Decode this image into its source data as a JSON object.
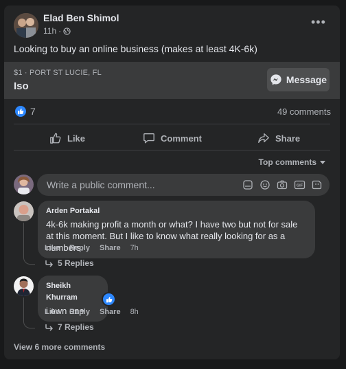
{
  "post": {
    "author": "Elad Ben Shimol",
    "time": "11h",
    "visibility_icon": "globe-icon",
    "more_icon": "more-dots-icon",
    "more_label": "•••",
    "text": "Looking to buy an online business (makes at least 4K-6k)"
  },
  "listing": {
    "location": "$1 · PORT ST LUCIE, FL",
    "title": "Iso",
    "message_label": "Message"
  },
  "reactions": {
    "count": "7",
    "comments": "49 comments"
  },
  "actions": {
    "like": "Like",
    "comment": "Comment",
    "share": "Share"
  },
  "sort": {
    "label": "Top comments"
  },
  "composer": {
    "placeholder": "Write a public comment...",
    "tools": [
      "sticker-icon",
      "emoji-icon",
      "camera-icon",
      "gif-icon",
      "avatar-sticker-icon"
    ]
  },
  "comments": [
    {
      "author": "Arden Portakal",
      "text": "4k-6k making profit a month or what? I have two but not for sale at this moment. But I like to know what really looking for as a numbers.",
      "like": "Like",
      "reply": "Reply",
      "share": "Share",
      "time": "7h",
      "replies": "5 Replies"
    },
    {
      "author": "Sheikh Khurram",
      "text": "i own one",
      "like": "Like",
      "reply": "Reply",
      "share": "Share",
      "time": "8h",
      "replies": "7 Replies"
    }
  ],
  "view_more": "View 6 more comments",
  "colors": {
    "background": "#18191a",
    "card": "#242526",
    "surface": "#3a3b3c",
    "accent": "#2d88ff",
    "secondary_text": "#b0b3b8"
  }
}
